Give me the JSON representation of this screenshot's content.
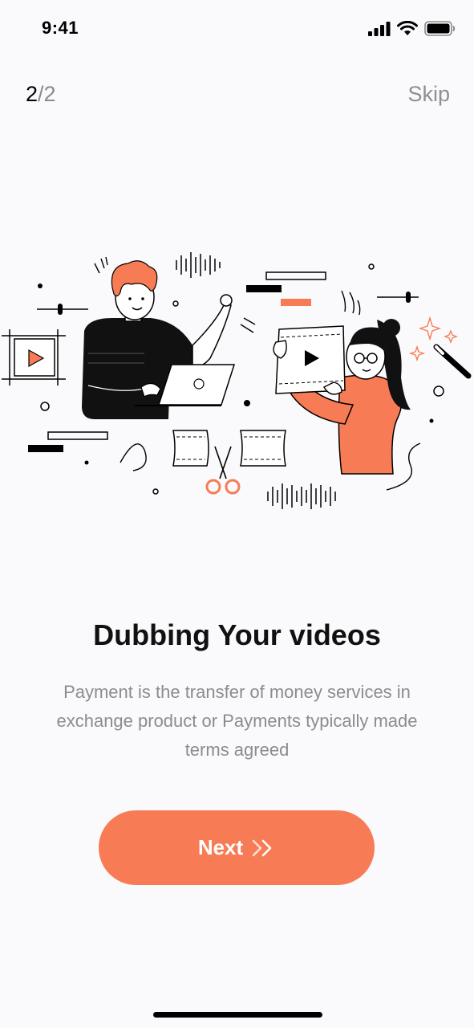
{
  "status_bar": {
    "time": "9:41"
  },
  "pager": {
    "current": "2",
    "total": "/2"
  },
  "skip_label": "Skip",
  "title": "Dubbing Your videos",
  "description": "Payment is the transfer of money services in exchange product or Payments typically made terms agreed",
  "next_label": "Next",
  "colors": {
    "accent": "#f77c55",
    "background": "#fafafc",
    "text_primary": "#111111",
    "text_secondary": "#8c8c8c"
  },
  "icons": [
    "cellular-signal-icon",
    "wifi-icon",
    "battery-icon",
    "double-chevron-right-icon"
  ]
}
